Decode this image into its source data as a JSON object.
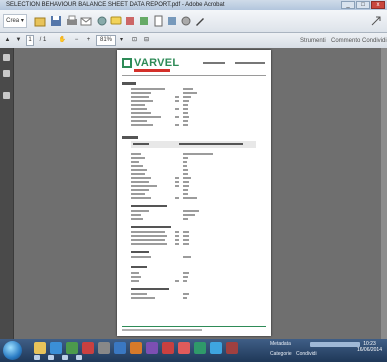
{
  "window": {
    "title": "SELECTION BEHAVIOUR BALANCE SHEET DATA REPORT.pdf - Adobe Acrobat",
    "minimize": "_",
    "maximize": "□",
    "close": "x"
  },
  "toolbar": {
    "create_label": "Crea",
    "create_arrow": "▾"
  },
  "nav": {
    "page_current": "1",
    "page_total": "/ 1",
    "zoom": "81%",
    "zoom_minus": "−",
    "zoom_plus": "+"
  },
  "panels": [
    {
      "label": "Strumenti"
    },
    {
      "label": "Commento"
    },
    {
      "label": "Condividi"
    }
  ],
  "document": {
    "brand": "VARVEL"
  },
  "taskbar": {
    "tray_label_1": "Metadata",
    "tray_label_2": "Categorie",
    "tray_label_3": "Condividi",
    "clock_time": "10:23",
    "clock_date": "16/06/2014"
  }
}
